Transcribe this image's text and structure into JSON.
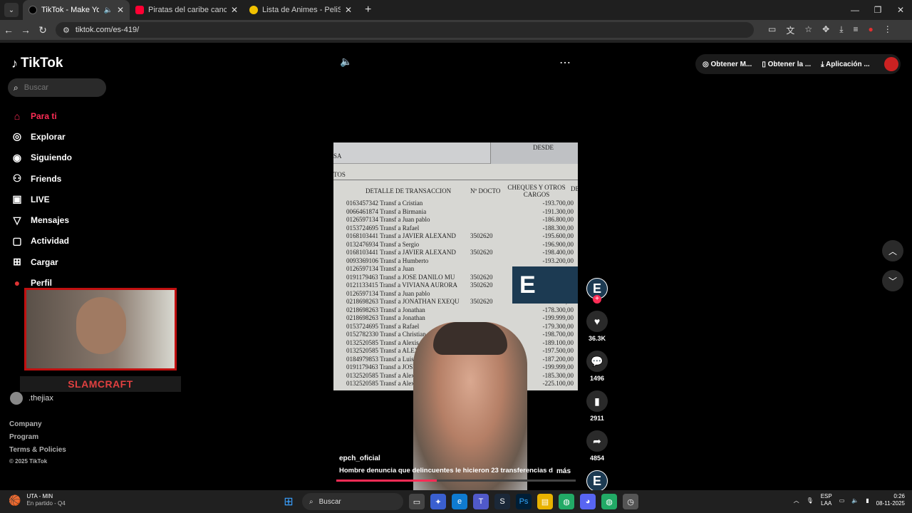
{
  "browser": {
    "tabs": [
      {
        "title": "TikTok - Make Your Day",
        "icon": "tiktok-icon",
        "color": "#000000",
        "active": true
      },
      {
        "title": "Piratas del caribe cancion compl",
        "icon": "youtube-icon",
        "color": "#ff0033",
        "active": false
      },
      {
        "title": "Lista de Animes - PeliSmart",
        "icon": "pelismart-icon",
        "color": "#f2c200",
        "active": false
      }
    ],
    "url": "tiktok.com/es-419/"
  },
  "sidebar": {
    "logo": "TikTok",
    "search_placeholder": "Buscar",
    "items": [
      {
        "label": "Para ti",
        "icon": "home-icon"
      },
      {
        "label": "Explorar",
        "icon": "compass-icon"
      },
      {
        "label": "Siguiendo",
        "icon": "following-icon"
      },
      {
        "label": "Friends",
        "icon": "friends-icon"
      },
      {
        "label": "LIVE",
        "icon": "live-icon"
      },
      {
        "label": "Mensajes",
        "icon": "messages-icon"
      },
      {
        "label": "Actividad",
        "icon": "activity-icon"
      },
      {
        "label": "Cargar",
        "icon": "upload-icon"
      },
      {
        "label": "Perfil",
        "icon": "profile-icon"
      }
    ],
    "accounts": [
      ".thejiax"
    ],
    "footer": [
      "Company",
      "Program",
      "Terms & Policies",
      "© 2025 TikTok"
    ]
  },
  "overlay": {
    "streamer": "SLAMCRAFT"
  },
  "header_buttons": [
    "Obtener M...",
    "Obtener la ...",
    "Aplicación ..."
  ],
  "video": {
    "author": "epch_oficial",
    "caption": "Hombre denuncia que delincuentes le hicieron 23 transferencias de ...",
    "more": "más",
    "likes": "36.3K",
    "comments": "1496",
    "saves": "2911",
    "shares": "4854",
    "progress": 0.42,
    "document": {
      "header_desde": "DESDE",
      "header_left": "SA",
      "header_tos": "TOS",
      "col_detail": "DETALLE DE TRANSACCION",
      "col_doc": "Nº DOCTO",
      "col_cheques": "CHEQUES Y OTROS CARGOS",
      "col_de": "DE",
      "rows": [
        {
          "d": "0163457342 Transf a Cristian",
          "n": "",
          "v": "-193.700,00"
        },
        {
          "d": "0066461874 Transf a Birmania",
          "n": "",
          "v": "-191.300,00"
        },
        {
          "d": "0126597134 Transf a Juan pablo",
          "n": "",
          "v": "-186.800,00"
        },
        {
          "d": "0153724695 Transf a Rafael",
          "n": "",
          "v": "-188.300,00"
        },
        {
          "d": "0168103441 Transf a JAVIER ALEXAND",
          "n": "3502620",
          "v": "-195.600,00"
        },
        {
          "d": "0132476934 Transf a Sergio",
          "n": "",
          "v": "-196.900,00"
        },
        {
          "d": "0168103441 Transf a JAVIER ALEXAND",
          "n": "3502620",
          "v": "-198.400,00"
        },
        {
          "d": "0093369106 Transf a Humberto",
          "n": "",
          "v": "-193.200,00"
        },
        {
          "d": "0126597134 Transf a Juan",
          "n": "",
          "v": ""
        },
        {
          "d": "0191179463 Transf a JOSE DANILO MU",
          "n": "3502620",
          "v": ""
        },
        {
          "d": "0121133415 Transf a VIVIANA AURORA",
          "n": "3502620",
          "v": ""
        },
        {
          "d": "0126597134 Transf a Juan pablo",
          "n": "",
          "v": ""
        },
        {
          "d": "0218698263 Transf a JONATHAN EXEQU",
          "n": "3502620",
          "v": "-199.800,00"
        },
        {
          "d": "0218698263 Transf a Jonathan",
          "n": "",
          "v": "-178.300,00"
        },
        {
          "d": "0218698263 Transf a Jonathan",
          "n": "",
          "v": "-199.999,00"
        },
        {
          "d": "0153724695 Transf a Rafael",
          "n": "",
          "v": "-179.300,00"
        },
        {
          "d": "0152782330 Transf a Christian",
          "n": "",
          "v": "-198.700,00"
        },
        {
          "d": "0132520585 Transf a Alexis",
          "n": "",
          "v": "-189.100,00"
        },
        {
          "d": "0132520585 Transf a ALEX",
          "n": "",
          "v": "-197.500,00"
        },
        {
          "d": "0184979853 Transf a Luis",
          "n": "",
          "v": "-187.200,00"
        },
        {
          "d": "0191179463 Transf a JOSE",
          "n": "",
          "v": "-199.999,00"
        },
        {
          "d": "0132520585 Transf a Alex",
          "n": "",
          "v": "-185.300,00"
        },
        {
          "d": "0132520585 Transf a Alex",
          "n": "",
          "v": "-225.100,00"
        }
      ]
    }
  },
  "taskbar": {
    "weather_title": "UTA - MIN",
    "weather_sub": "En partido - Q4",
    "search": "Buscar",
    "lang": "ESP",
    "lang2": "LAA",
    "time": "0:26",
    "date": "08-11-2025"
  }
}
